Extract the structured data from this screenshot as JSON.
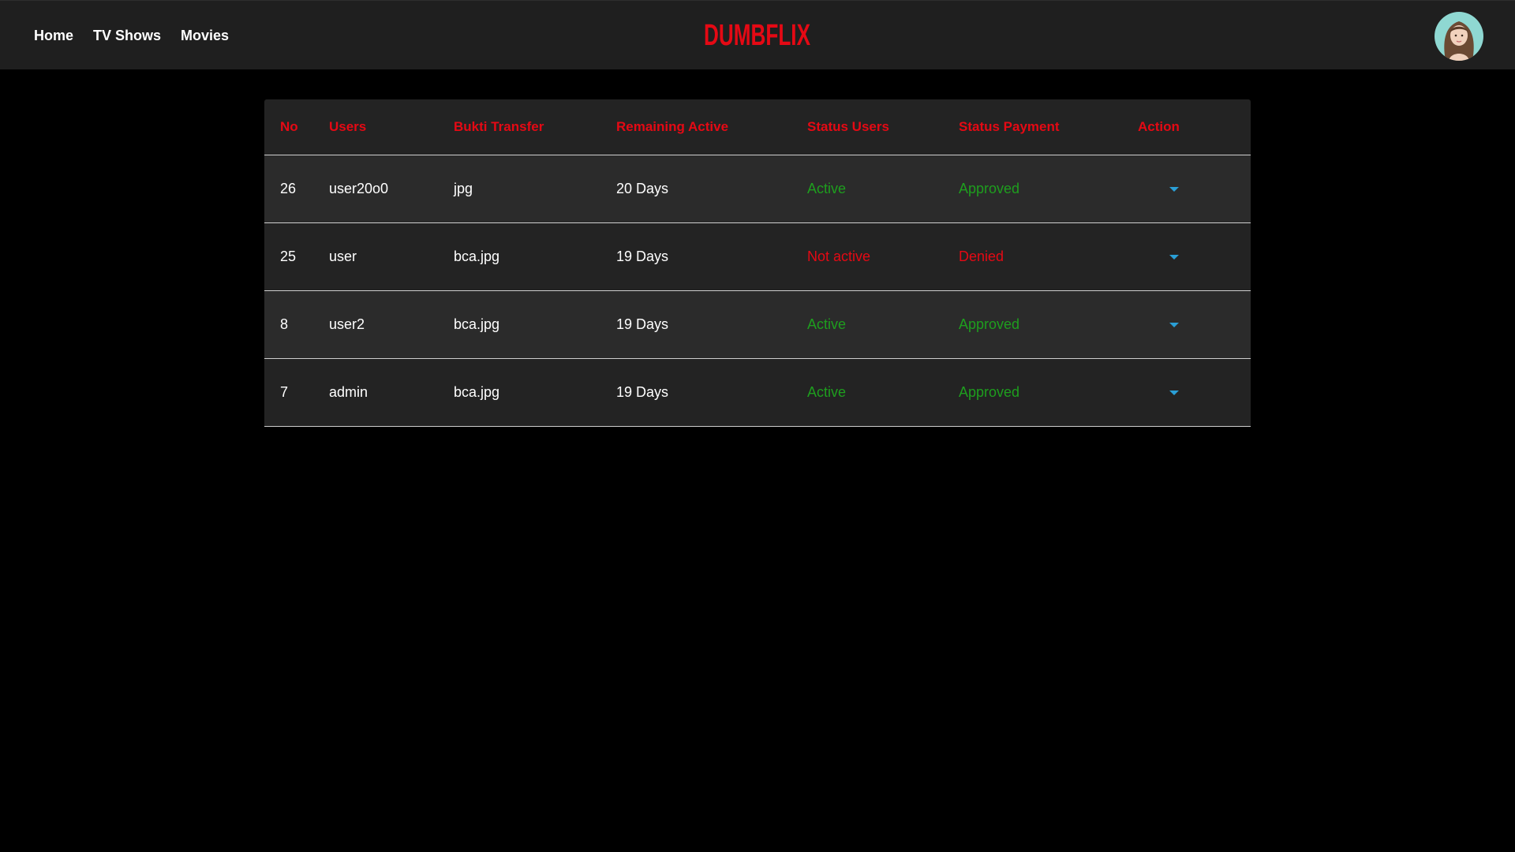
{
  "nav": {
    "links": [
      {
        "label": "Home"
      },
      {
        "label": "TV Shows"
      },
      {
        "label": "Movies"
      }
    ],
    "logo_text": "DUMBFLIX",
    "logo_color": "#e50914"
  },
  "colors": {
    "accent": "#e50914",
    "status_positive": "#1e9e1e",
    "status_negative": "#e50914",
    "action_caret": "#2a9fd6"
  },
  "table": {
    "headers": [
      "No",
      "Users",
      "Bukti Transfer",
      "Remaining Active",
      "Status Users",
      "Status Payment",
      "Action"
    ],
    "rows": [
      {
        "no": "26",
        "user": "user20o0",
        "bukti": "jpg",
        "remaining": "20 Days",
        "status_user": "Active",
        "status_user_tone": "positive",
        "status_payment": "Approved",
        "status_payment_tone": "positive",
        "action_icon": "caret-down-icon"
      },
      {
        "no": "25",
        "user": "user",
        "bukti": "bca.jpg",
        "remaining": "19 Days",
        "status_user": "Not active",
        "status_user_tone": "negative",
        "status_payment": "Denied",
        "status_payment_tone": "negative",
        "action_icon": "caret-down-icon"
      },
      {
        "no": "8",
        "user": "user2",
        "bukti": "bca.jpg",
        "remaining": "19 Days",
        "status_user": "Active",
        "status_user_tone": "positive",
        "status_payment": "Approved",
        "status_payment_tone": "positive",
        "action_icon": "caret-down-icon"
      },
      {
        "no": "7",
        "user": "admin",
        "bukti": "bca.jpg",
        "remaining": "19 Days",
        "status_user": "Active",
        "status_user_tone": "positive",
        "status_payment": "Approved",
        "status_payment_tone": "positive",
        "action_icon": "caret-down-icon"
      }
    ]
  }
}
